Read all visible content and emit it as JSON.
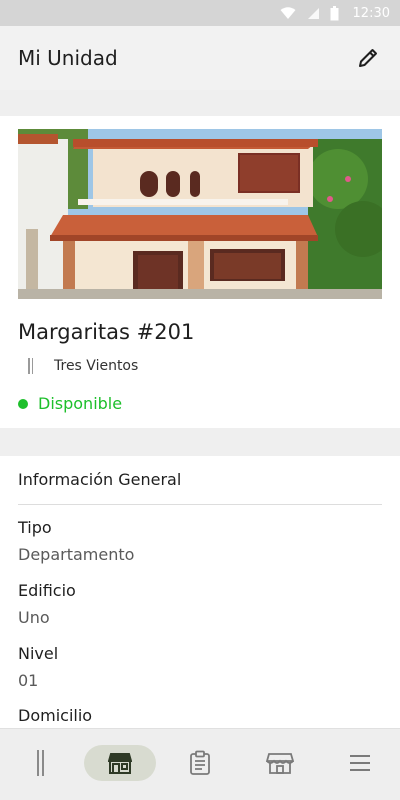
{
  "status_bar": {
    "time": "12:30"
  },
  "app_bar": {
    "title": "Mi Unidad",
    "edit_icon": "pencil-icon"
  },
  "unit": {
    "name": "Margaritas #201",
    "complex": "Tres Vientos",
    "status": "Disponible",
    "status_color": "#1dbf2b"
  },
  "info": {
    "section_title": "Información General",
    "fields": [
      {
        "label": "Tipo",
        "value": "Departamento"
      },
      {
        "label": "Edificio",
        "value": "Uno"
      },
      {
        "label": "Nivel",
        "value": "01"
      },
      {
        "label": "Domicilio",
        "value": ""
      }
    ]
  },
  "bottom_nav": {
    "items": [
      {
        "icon": "complex-icon",
        "active": false
      },
      {
        "icon": "unit-icon",
        "active": true
      },
      {
        "icon": "clipboard-icon",
        "active": false
      },
      {
        "icon": "store-icon",
        "active": false
      },
      {
        "icon": "menu-icon",
        "active": false
      }
    ]
  }
}
